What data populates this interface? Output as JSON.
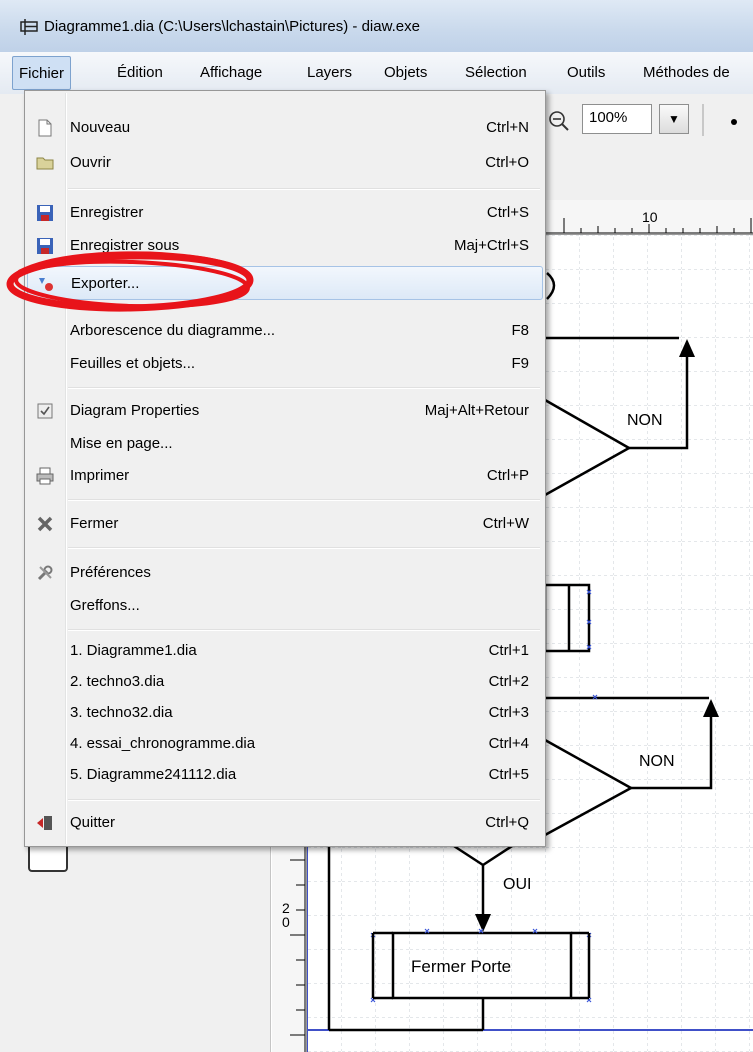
{
  "window": {
    "title": "Diagramme1.dia (C:\\Users\\lchastain\\Pictures) - diaw.exe"
  },
  "menubar": {
    "items": [
      {
        "label": "Fichier"
      },
      {
        "label": "Édition"
      },
      {
        "label": "Affichage"
      },
      {
        "label": "Layers"
      },
      {
        "label": "Objets"
      },
      {
        "label": "Sélection"
      },
      {
        "label": "Outils"
      },
      {
        "label": "Méthodes de"
      }
    ]
  },
  "toolbar": {
    "zoom_value": "100%"
  },
  "ruler": {
    "h_label": "10",
    "v_label_1": "2",
    "v_label_2": "0"
  },
  "fichier_menu": {
    "items": [
      {
        "label": "Nouveau",
        "shortcut": "Ctrl+N",
        "icon": "new-document-icon"
      },
      {
        "label": "Ouvrir",
        "shortcut": "Ctrl+O",
        "icon": "folder-open-icon"
      },
      {
        "label": "Enregistrer",
        "shortcut": "Ctrl+S",
        "icon": "save-icon"
      },
      {
        "label": "Enregistrer sous",
        "shortcut": "Maj+Ctrl+S",
        "icon": "save-as-icon"
      },
      {
        "label": "Exporter...",
        "shortcut": "",
        "icon": "export-icon"
      },
      {
        "label": "Arborescence du diagramme...",
        "shortcut": "F8",
        "icon": ""
      },
      {
        "label": "Feuilles et objets...",
        "shortcut": "F9",
        "icon": ""
      },
      {
        "label": "Diagram Properties",
        "shortcut": "Maj+Alt+Retour",
        "icon": "properties-icon"
      },
      {
        "label": "Mise en page...",
        "shortcut": "",
        "icon": ""
      },
      {
        "label": "Imprimer",
        "shortcut": "Ctrl+P",
        "icon": "printer-icon"
      },
      {
        "label": "Fermer",
        "shortcut": "Ctrl+W",
        "icon": "close-icon"
      },
      {
        "label": "Préférences",
        "shortcut": "",
        "icon": "preferences-icon"
      },
      {
        "label": "Greffons...",
        "shortcut": "",
        "icon": ""
      },
      {
        "label": "1. Diagramme1.dia",
        "shortcut": "Ctrl+1",
        "icon": ""
      },
      {
        "label": "2. techno3.dia",
        "shortcut": "Ctrl+2",
        "icon": ""
      },
      {
        "label": "3. techno32.dia",
        "shortcut": "Ctrl+3",
        "icon": ""
      },
      {
        "label": "4. essai_chronogramme.dia",
        "shortcut": "Ctrl+4",
        "icon": ""
      },
      {
        "label": "5. Diagramme241112.dia",
        "shortcut": "Ctrl+5",
        "icon": ""
      },
      {
        "label": "Quitter",
        "shortcut": "Ctrl+Q",
        "icon": "quit-icon"
      }
    ]
  },
  "diagram": {
    "label_non_1": "NON",
    "label_non_2": "NON",
    "label_oui": "OUI",
    "box_label": "Fermer Porte"
  },
  "colors": {
    "menu_bg": "#f0f0f0",
    "highlight_border": "#a6c3e6",
    "annotation_red": "#e8141a"
  }
}
